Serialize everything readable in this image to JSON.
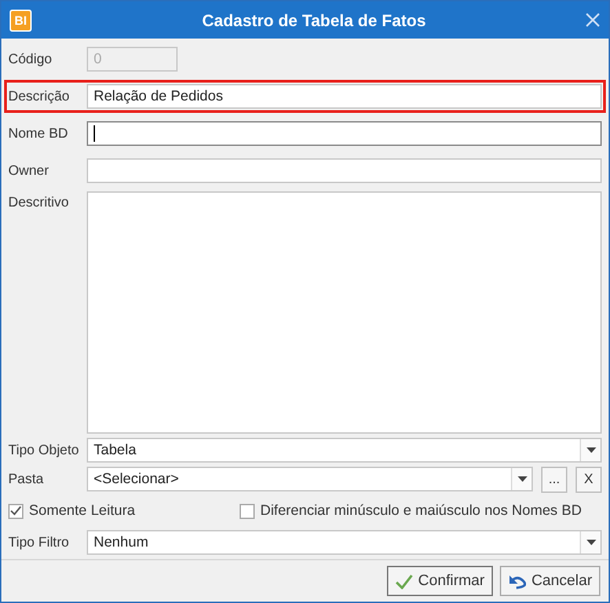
{
  "window": {
    "logo": "BI",
    "title": "Cadastro de Tabela de Fatos"
  },
  "form": [
    {
      "kind": "text",
      "label": "Código",
      "value": "0",
      "disabled": true,
      "highlighted": false,
      "focused": false
    },
    {
      "kind": "text",
      "label": "Descrição",
      "value": "Relação de Pedidos",
      "disabled": false,
      "highlighted": true,
      "focused": false
    },
    {
      "kind": "text",
      "label": "Nome BD",
      "disabled": false,
      "highlighted": false,
      "focused": true
    },
    {
      "kind": "text",
      "label": "Owner",
      "disabled": false,
      "highlighted": false,
      "focused": false
    },
    {
      "kind": "textarea",
      "label": "Descritivo"
    },
    {
      "kind": "combo",
      "label": "Tipo Objeto",
      "value": "Tabela"
    },
    {
      "kind": "combo",
      "label": "Pasta",
      "value": "<Selecionar>",
      "extra_buttons": [
        "...",
        "X"
      ]
    },
    {
      "kind": "checkboxes",
      "options": [
        {
          "label": "Somente Leitura",
          "checked": true
        },
        {
          "label": "Diferenciar minúsculo e maiúsculo nos Nomes BD",
          "checked": false
        }
      ]
    },
    {
      "kind": "combo",
      "label": "Tipo Filtro",
      "value": "Nenhum"
    }
  ],
  "buttons": [
    {
      "kind": "confirm",
      "label": "Confirmar"
    },
    {
      "kind": "cancel",
      "label": "Cancelar"
    }
  ]
}
